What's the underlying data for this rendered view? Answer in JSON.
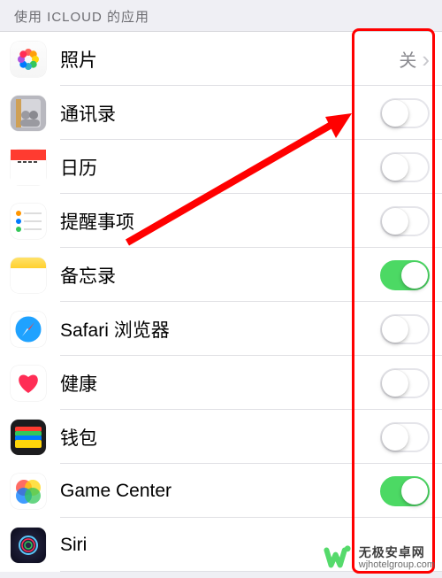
{
  "header": {
    "title": "使用 ICLOUD 的应用"
  },
  "items": [
    {
      "id": "photos",
      "label": "照片",
      "type": "link",
      "value_text": "关",
      "on": false
    },
    {
      "id": "contacts",
      "label": "通讯录",
      "type": "toggle",
      "on": false
    },
    {
      "id": "calendar",
      "label": "日历",
      "type": "toggle",
      "on": false
    },
    {
      "id": "reminders",
      "label": "提醒事项",
      "type": "toggle",
      "on": false
    },
    {
      "id": "notes",
      "label": "备忘录",
      "type": "toggle",
      "on": true
    },
    {
      "id": "safari",
      "label": "Safari 浏览器",
      "type": "toggle",
      "on": false
    },
    {
      "id": "health",
      "label": "健康",
      "type": "toggle",
      "on": false
    },
    {
      "id": "wallet",
      "label": "钱包",
      "type": "toggle",
      "on": false
    },
    {
      "id": "gamecenter",
      "label": "Game Center",
      "type": "toggle",
      "on": true
    },
    {
      "id": "siri",
      "label": "Siri",
      "type": "toggle",
      "on": false
    }
  ],
  "annotation": {
    "highlight_color": "#ff0000",
    "arrow_color": "#ff0000"
  },
  "watermark": {
    "title": "无极安卓网",
    "url": "wjhotelgroup.com",
    "logo_color": "#4cd964"
  }
}
